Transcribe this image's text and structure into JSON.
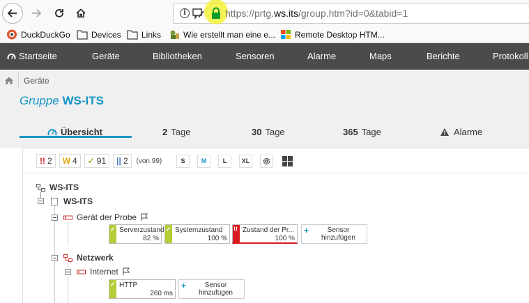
{
  "browser": {
    "url_prefix": "https://prtg.",
    "url_domain": "ws.its",
    "url_suffix": "/group.htm?id=0&tabid=1"
  },
  "bookmarks": [
    {
      "label": "DuckDuckGo",
      "icon": "duckduckgo-icon"
    },
    {
      "label": "Devices",
      "icon": "folder-icon"
    },
    {
      "label": "Links",
      "icon": "folder-icon"
    },
    {
      "label": "Wie erstellt man eine e...",
      "icon": "page-icon"
    },
    {
      "label": "Remote Desktop HTM...",
      "icon": "windows-icon"
    }
  ],
  "topnav": [
    "Startseite",
    "Geräte",
    "Bibliotheken",
    "Sensoren",
    "Alarme",
    "Maps",
    "Berichte",
    "Protokoll"
  ],
  "breadcrumb": "Geräte",
  "title": {
    "prefix": "Gruppe",
    "name": "WS-ITS"
  },
  "tabs": [
    {
      "num": "",
      "label": "Übersicht"
    },
    {
      "num": "2",
      "label": "Tage"
    },
    {
      "num": "30",
      "label": "Tage"
    },
    {
      "num": "365",
      "label": "Tage"
    },
    {
      "num": "",
      "label": "Alarme"
    }
  ],
  "status": {
    "down": {
      "symbol": "!!",
      "count": "2",
      "color": "#d71920"
    },
    "warning": {
      "symbol": "W",
      "count": "4",
      "color": "#ffcb05"
    },
    "up": {
      "symbol": "✓",
      "count": "91",
      "color": "#b4cc38"
    },
    "paused": {
      "symbol": "||",
      "count": "2",
      "color": "#447fc1"
    },
    "total": "(von 99)"
  },
  "sizes": [
    "S",
    "M",
    "L",
    "XL"
  ],
  "tree": {
    "root": "WS-ITS",
    "group": "WS-ITS",
    "probe_device": "Gerät der Probe",
    "network": "Netzwerk",
    "internet": "Internet"
  },
  "probe_sensors": [
    {
      "name": "Serverzustand",
      "value": "82 %",
      "status": "up"
    },
    {
      "name": "Systemzustand",
      "value": "100 %",
      "status": "up"
    },
    {
      "name": "Zustand der Pr...",
      "value": "100 %",
      "status": "down"
    }
  ],
  "internet_sensors": [
    {
      "name": "HTTP",
      "value": "260 ms",
      "status": "up"
    }
  ],
  "add_sensor_label": "Sensor hinzufügen",
  "colors": {
    "accent": "#1795c6",
    "up": "#b4cc38",
    "down": "#d71920",
    "nav": "#4b4b4b"
  }
}
